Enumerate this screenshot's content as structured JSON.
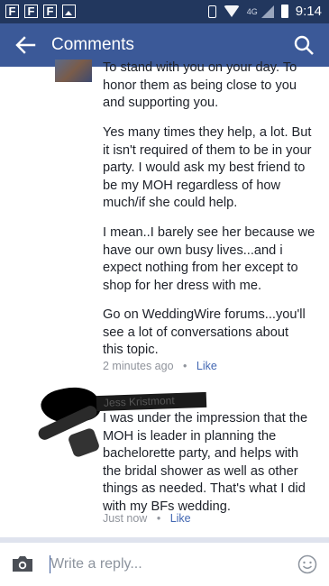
{
  "status_bar": {
    "notification_icons": [
      "F",
      "F",
      "F"
    ],
    "network": "4G",
    "time": "9:14"
  },
  "header": {
    "title": "Comments"
  },
  "comments": [
    {
      "paragraphs": [
        [
          "To stand with you on your day. To",
          "honor them as being close to you",
          "and supporting you."
        ],
        [
          "Yes many times they help, a lot. But",
          "it isn't required of them to be in your",
          "party. I would ask my best friend to",
          "be my MOH regardless of how",
          "much/if she could help."
        ],
        [
          "I mean..I barely see her because we",
          "have our own busy lives...and i",
          "expect nothing from her except to",
          "shop for her dress with me."
        ],
        [
          "Go on WeddingWire forums...you'll",
          "see a lot of conversations about",
          "this topic."
        ]
      ],
      "time": "2 minutes ago",
      "separator": "•",
      "like": "Like"
    },
    {
      "author": "Jess Kristmont",
      "paragraphs": [
        [
          "I was under the impression that the",
          "MOH is leader in planning the",
          "bachelorette party, and helps with",
          "the bridal shower as well as other",
          "things as needed. That's what I did",
          "with my BFs wedding."
        ]
      ],
      "time": "Just now",
      "separator": "•",
      "like": "Like"
    }
  ],
  "reply": {
    "placeholder": "Write a reply..."
  },
  "colors": {
    "status_bar": "#22375e",
    "app_bar": "#3b5998",
    "link": "#4267b2",
    "meta": "#90949c"
  }
}
